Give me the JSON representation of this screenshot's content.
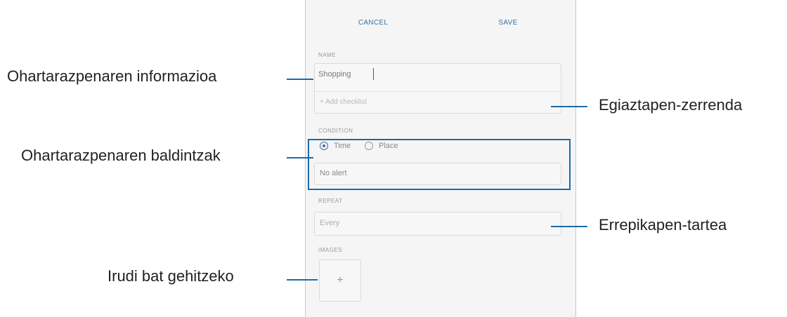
{
  "topbar": {
    "cancel_label": "CANCEL",
    "save_label": "SAVE"
  },
  "name_section": {
    "label": "NAME",
    "value": "Shopping",
    "add_checklist_placeholder": "+ Add checklist"
  },
  "condition_section": {
    "label": "CONDITION",
    "options": [
      "Time",
      "Place"
    ],
    "selected": "Time",
    "alert_value": "No alert"
  },
  "repeat_section": {
    "label": "REPEAT",
    "value": "Every"
  },
  "images_section": {
    "label": "IMAGES",
    "add_icon": "plus-icon"
  },
  "callouts": {
    "alert_info": "Ohartarazpenaren informazioa",
    "checklist": "Egiaztapen-zerrenda",
    "alert_conditions": "Ohartarazpenaren baldintzak",
    "repeat_interval": "Errepikapen-tartea",
    "add_image": "Irudi bat gehitzeko"
  },
  "colors": {
    "accent": "#1d6ba8",
    "link": "#3b6fa3"
  }
}
